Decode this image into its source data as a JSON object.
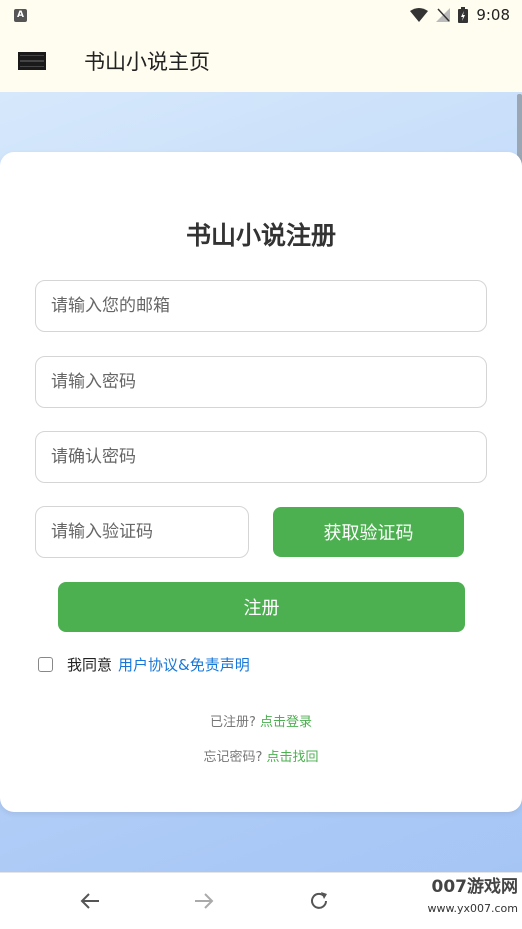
{
  "status_bar": {
    "app_icon_letter": "A",
    "time": "9:08"
  },
  "app_bar": {
    "title": "书山小说主页"
  },
  "form": {
    "title": "书山小说注册",
    "email_placeholder": "请输入您的邮箱",
    "password_placeholder": "请输入密码",
    "confirm_password_placeholder": "请确认密码",
    "code_placeholder": "请输入验证码",
    "get_code_label": "获取验证码",
    "register_label": "注册",
    "agree_text": "我同意",
    "agreement_link": "用户协议&免责声明",
    "registered_text": "已注册?",
    "login_link": "点击登录",
    "forgot_text": "忘记密码?",
    "recover_link": "点击找回"
  },
  "nav_bar": {
    "back_icon": "arrow-left-icon",
    "forward_icon": "arrow-right-icon",
    "reload_icon": "reload-icon"
  },
  "watermark": {
    "brand": "007游戏网",
    "site": "www.yx007.com"
  },
  "colors": {
    "accent_green": "#4caf50",
    "link_blue": "#1677d8",
    "appbar_bg": "#fffdf0"
  }
}
